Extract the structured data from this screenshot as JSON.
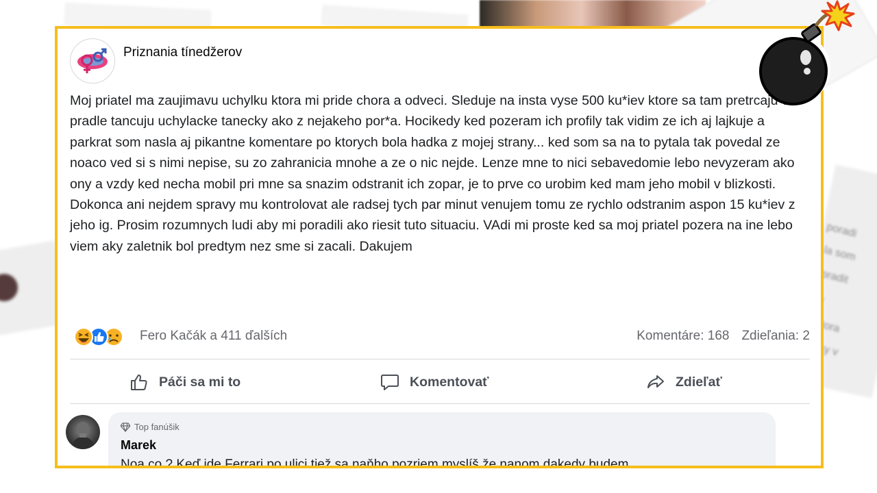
{
  "post": {
    "page_name": "Priznania tínedžerov",
    "text": "Moj priatel ma zaujimavu uchylku ktora mi pride chora a odveci. Sleduje na insta vyse 500 ku*iev ktore sa tam pretrcaju v pradle tancuju uchylacke tanecky ako z nejakeho por*a. Hocikedy ked pozeram ich profily tak vidim ze ich aj lajkuje a parkrat som nasla aj pikantne komentare po ktorych bola hadka z mojej strany... ked som sa na to pytala tak povedal ze noaco ved si s nimi nepise, su zo zahranicia mnohe a ze o nic nejde. Lenze mne to nici sebavedomie lebo nevyzeram ako ony a vzdy ked necha mobil pri mne sa snazim odstranit ich zopar, je to prve co urobim ked mam jeho mobil v blizkosti. Dokonca ani nejdem spravy mu kontrolovat ale radsej tych par minut venujem tomu ze rychlo odstranim aspon 15 ku*iev z jeho ig. Prosim rozumnych ludi aby mi poradili ako riesit tuto situaciu. VAdi mi proste ked sa moj priatel pozera na ine lebo viem aky zaletnik bol predtym nez sme si zacali. Dakujem",
    "reactions_text": "Fero Kačák a 411 ďalších",
    "comments_count": "Komentáre: 168",
    "shares_count": "Zdieľania: 2",
    "reaction_icons": [
      "haha-icon",
      "like-icon",
      "sad-icon"
    ]
  },
  "actions": {
    "like_label": "Páči sa mi to",
    "comment_label": "Komentovať",
    "share_label": "Zdieľať"
  },
  "comment": {
    "badge": "Top fanúšik",
    "author": "Marek",
    "text": "Noa co ? Keď ide Ferrari po ulici tiež sa naňho pozriem myslíš že nanom dakedy budem"
  },
  "colors": {
    "frame": "#f6be1b",
    "text": "#1c1e21",
    "secondary": "#65676b",
    "like_blue": "#1877f2"
  }
}
